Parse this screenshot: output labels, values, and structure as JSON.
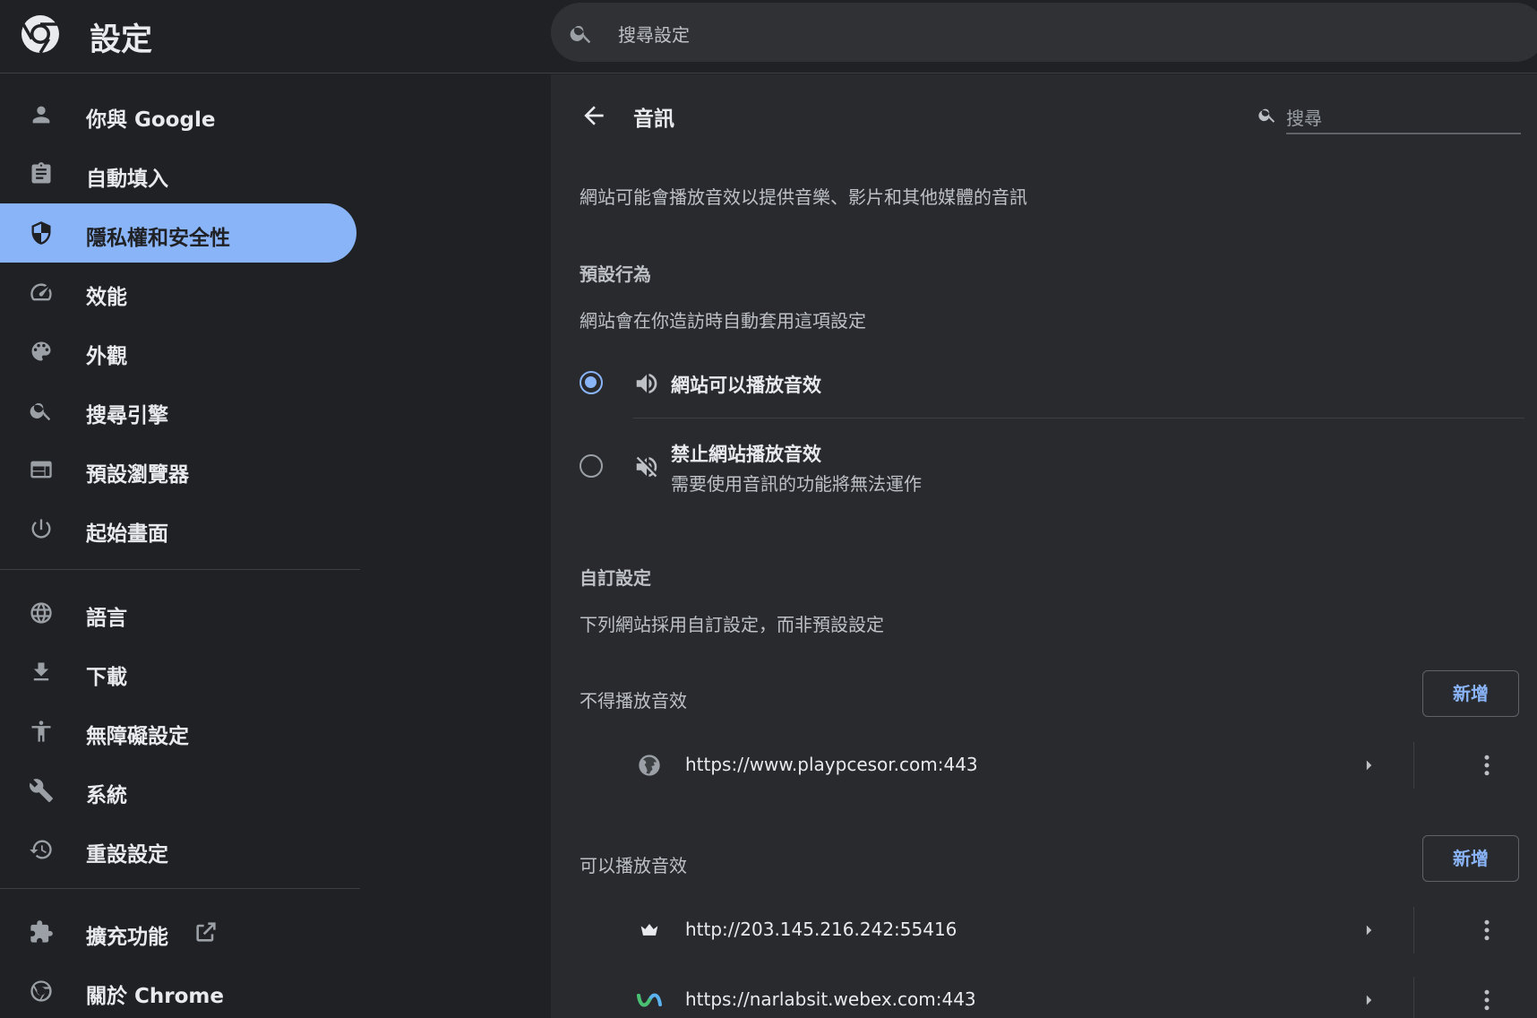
{
  "app": {
    "title": "設定",
    "search_placeholder": "搜尋設定"
  },
  "sidebar": {
    "items": [
      {
        "label": "你與 Google",
        "icon": "person-icon"
      },
      {
        "label": "自動填入",
        "icon": "clipboard-icon"
      },
      {
        "label": "隱私權和安全性",
        "icon": "shield-icon",
        "active": true
      },
      {
        "label": "效能",
        "icon": "speedometer-icon"
      },
      {
        "label": "外觀",
        "icon": "palette-icon"
      },
      {
        "label": "搜尋引擎",
        "icon": "search-icon"
      },
      {
        "label": "預設瀏覽器",
        "icon": "browser-window-icon"
      },
      {
        "label": "起始畫面",
        "icon": "power-icon"
      },
      {
        "label": "語言",
        "icon": "globe-icon"
      },
      {
        "label": "下載",
        "icon": "download-icon"
      },
      {
        "label": "無障礙設定",
        "icon": "accessibility-icon"
      },
      {
        "label": "系統",
        "icon": "wrench-icon"
      },
      {
        "label": "重設設定",
        "icon": "history-icon"
      },
      {
        "label": "擴充功能",
        "icon": "puzzle-icon"
      },
      {
        "label": "關於 Chrome",
        "icon": "chrome-icon"
      }
    ]
  },
  "main": {
    "title": "音訊",
    "search_placeholder": "搜尋",
    "description": "網站可能會播放音效以提供音樂、影片和其他媒體的音訊",
    "default_behavior": {
      "heading": "預設行為",
      "description": "網站會在你造訪時自動套用這項設定",
      "options": [
        {
          "label": "網站可以播放音效",
          "sublabel": "",
          "icon": "volume-icon",
          "checked": true
        },
        {
          "label": "禁止網站播放音效",
          "sublabel": "需要使用音訊的功能將無法運作",
          "icon": "volume-off-icon",
          "checked": false
        }
      ]
    },
    "custom": {
      "heading": "自訂設定",
      "description": "下列網站採用自訂設定，而非預設設定",
      "blocked": {
        "heading": "不得播放音效",
        "add_label": "新增",
        "sites": [
          {
            "url": "https://www.playpcesor.com:443",
            "icon": "globe-icon"
          }
        ]
      },
      "allowed": {
        "heading": "可以播放音效",
        "add_label": "新增",
        "sites": [
          {
            "url": "http://203.145.216.242:55416",
            "icon": "crown-icon"
          },
          {
            "url": "https://narlabsit.webex.com:443",
            "icon": "webex-icon"
          }
        ]
      }
    }
  },
  "colors": {
    "accent": "#8ab4f8",
    "background": "#202124",
    "panel": "#292a2d"
  }
}
